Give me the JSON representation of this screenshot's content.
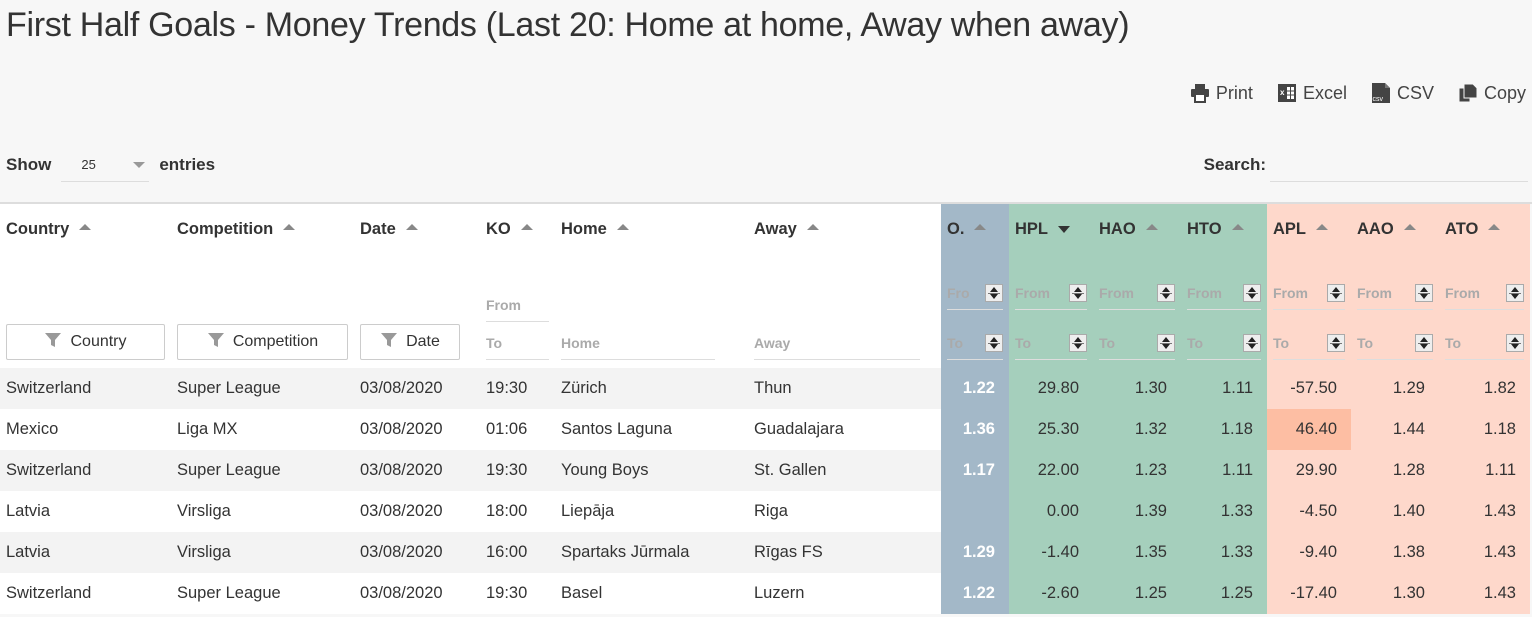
{
  "page": {
    "title": "First Half Goals - Money Trends (Last 20: Home at home, Away when away)"
  },
  "export": {
    "print": {
      "label": "Print",
      "icon": "printer-icon"
    },
    "excel": {
      "label": "Excel",
      "icon": "excel-file-icon"
    },
    "csv": {
      "label": "CSV",
      "icon": "csv-file-icon"
    },
    "copy": {
      "label": "Copy",
      "icon": "copy-icon"
    }
  },
  "length": {
    "show_label": "Show",
    "value": "25",
    "entries_label": "entries"
  },
  "search": {
    "label": "Search:",
    "value": ""
  },
  "colors": {
    "o_column": "#a3b8c8",
    "home_group": "#a5cfbc",
    "away_group": "#fed8cb",
    "highlight": "#fdbea3"
  },
  "columns": [
    {
      "key": "country",
      "label": "Country",
      "sort": "asc"
    },
    {
      "key": "competition",
      "label": "Competition",
      "sort": "asc"
    },
    {
      "key": "date",
      "label": "Date",
      "sort": "asc"
    },
    {
      "key": "ko",
      "label": "KO",
      "sort": "asc"
    },
    {
      "key": "home",
      "label": "Home",
      "sort": "asc"
    },
    {
      "key": "away",
      "label": "Away",
      "sort": "asc"
    },
    {
      "key": "o",
      "label": "O.",
      "sort": "asc"
    },
    {
      "key": "hpl",
      "label": "HPL",
      "sort": "desc"
    },
    {
      "key": "hao",
      "label": "HAO",
      "sort": "asc"
    },
    {
      "key": "hto",
      "label": "HTO",
      "sort": "asc"
    },
    {
      "key": "apl",
      "label": "APL",
      "sort": "asc"
    },
    {
      "key": "aao",
      "label": "AAO",
      "sort": "asc"
    },
    {
      "key": "ato",
      "label": "ATO",
      "sort": "asc"
    }
  ],
  "filters": {
    "country": "Country",
    "competition": "Competition",
    "date": "Date",
    "ko_from": "From",
    "ko_to": "To",
    "home_placeholder": "Home",
    "away_placeholder": "Away",
    "from_placeholder": "From",
    "to_placeholder": "To",
    "o_from_truncated": "Fro"
  },
  "rows": [
    {
      "country": "Switzerland",
      "competition": "Super League",
      "date": "03/08/2020",
      "ko": "19:30",
      "home": "Zürich",
      "away": "Thun",
      "o": "1.22",
      "hpl": "29.80",
      "hao": "1.30",
      "hto": "1.11",
      "apl": "-57.50",
      "aao": "1.29",
      "ato": "1.82",
      "apl_highlight": false
    },
    {
      "country": "Mexico",
      "competition": "Liga MX",
      "date": "03/08/2020",
      "ko": "01:06",
      "home": "Santos Laguna",
      "away": "Guadalajara",
      "o": "1.36",
      "hpl": "25.30",
      "hao": "1.32",
      "hto": "1.18",
      "apl": "46.40",
      "aao": "1.44",
      "ato": "1.18",
      "apl_highlight": true
    },
    {
      "country": "Switzerland",
      "competition": "Super League",
      "date": "03/08/2020",
      "ko": "19:30",
      "home": "Young Boys",
      "away": "St. Gallen",
      "o": "1.17",
      "hpl": "22.00",
      "hao": "1.23",
      "hto": "1.11",
      "apl": "29.90",
      "aao": "1.28",
      "ato": "1.11",
      "apl_highlight": false
    },
    {
      "country": "Latvia",
      "competition": "Virsliga",
      "date": "03/08/2020",
      "ko": "18:00",
      "home": "Liepāja",
      "away": "Riga",
      "o": "",
      "hpl": "0.00",
      "hao": "1.39",
      "hto": "1.33",
      "apl": "-4.50",
      "aao": "1.40",
      "ato": "1.43",
      "apl_highlight": false
    },
    {
      "country": "Latvia",
      "competition": "Virsliga",
      "date": "03/08/2020",
      "ko": "16:00",
      "home": "Spartaks Jūrmala",
      "away": "Rīgas FS",
      "o": "1.29",
      "hpl": "-1.40",
      "hao": "1.35",
      "hto": "1.33",
      "apl": "-9.40",
      "aao": "1.38",
      "ato": "1.43",
      "apl_highlight": false
    },
    {
      "country": "Switzerland",
      "competition": "Super League",
      "date": "03/08/2020",
      "ko": "19:30",
      "home": "Basel",
      "away": "Luzern",
      "o": "1.22",
      "hpl": "-2.60",
      "hao": "1.25",
      "hto": "1.25",
      "apl": "-17.40",
      "aao": "1.30",
      "ato": "1.43",
      "apl_highlight": false
    }
  ]
}
